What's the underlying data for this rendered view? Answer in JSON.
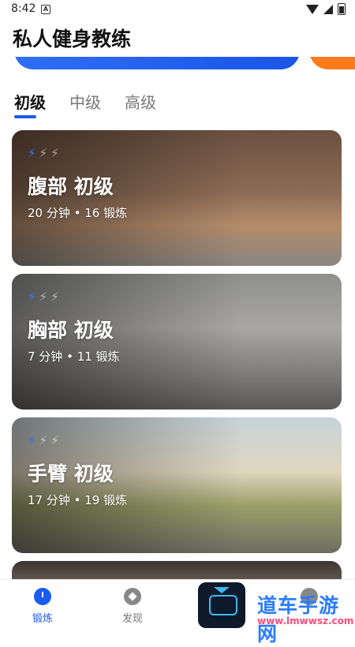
{
  "status_bar": {
    "time": "8:42",
    "notification_icon": "a-box-icon",
    "icons": [
      "wifi-icon",
      "cellular-icon",
      "battery-icon"
    ]
  },
  "app": {
    "title": "私人健身教练"
  },
  "tabs": [
    {
      "label": "初级",
      "active": true
    },
    {
      "label": "中级",
      "active": false
    },
    {
      "label": "高级",
      "active": false
    }
  ],
  "cards": [
    {
      "title": "腹部 初级",
      "meta": "20 分钟 • 16 锻炼",
      "difficulty": 1,
      "max_difficulty": 3
    },
    {
      "title": "胸部 初级",
      "meta": "7 分钟 • 11 锻炼",
      "difficulty": 1,
      "max_difficulty": 3
    },
    {
      "title": "手臂 初级",
      "meta": "17 分钟 • 19 锻炼",
      "difficulty": 1,
      "max_difficulty": 3
    }
  ],
  "bottom_nav": [
    {
      "label": "锻炼",
      "icon": "stopwatch-icon",
      "active": true
    },
    {
      "label": "发现",
      "icon": "compass-icon",
      "active": false
    }
  ],
  "watermark": {
    "text": "道车手游网",
    "url": "www.lmwwsz.com"
  },
  "colors": {
    "accent": "#1a5cf0",
    "bolt_active": "#2b7bff",
    "banner_orange": "#ff7a1a"
  }
}
